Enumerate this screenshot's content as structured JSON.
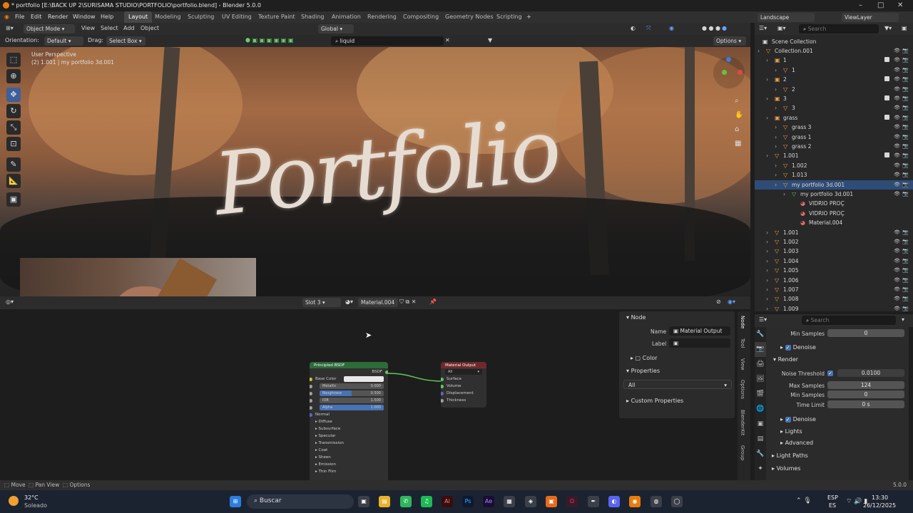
{
  "window": {
    "title": "* portfolio [E:\\BACK UP 2\\SURISAMA STUDIO\\PORTFOLIO\\portfolio.blend] - Blender 5.0.0"
  },
  "menu": [
    "File",
    "Edit",
    "Render",
    "Window",
    "Help"
  ],
  "workspaces": [
    "Layout",
    "Modeling",
    "Sculpting",
    "UV Editing",
    "Texture Paint",
    "Shading",
    "Animation",
    "Rendering",
    "Compositing",
    "Geometry Nodes",
    "Scripting"
  ],
  "active_workspace": "Layout",
  "scene": {
    "name": "Landscape",
    "view_layer": "ViewLayer"
  },
  "viewport_header": {
    "mode": "Object Mode",
    "view": "View",
    "select": "Select",
    "add": "Add",
    "object": "Object",
    "transform": "Global",
    "orientation_label": "Orientation:",
    "orientation": "Default",
    "drag_label": "Drag:",
    "drag": "Select Box",
    "search_value": "liquid",
    "options": "Options"
  },
  "viewport": {
    "info_line1": "User Perspective",
    "info_line2": "(2) 1.001 | my portfolio 3d.001",
    "text_object": "Portfolio"
  },
  "node_editor": {
    "slot": "Slot 3",
    "material": "Material.004",
    "bsdf_node": {
      "title": "Principled BSDF",
      "out": "BSDF",
      "rows": [
        {
          "label": "Base Color",
          "value": ""
        },
        {
          "label": "Metallic",
          "value": "0.000"
        },
        {
          "label": "Roughness",
          "value": "0.500"
        },
        {
          "label": "IOR",
          "value": "1.500"
        },
        {
          "label": "Alpha",
          "value": "1.000"
        }
      ],
      "sections": [
        "Normal",
        "Diffuse",
        "Subsurface",
        "Specular",
        "Transmission",
        "Coat",
        "Sheen",
        "Emission",
        "Thin Film"
      ]
    },
    "output_node": {
      "title": "Material Output",
      "target": "All",
      "inputs": [
        "Surface",
        "Volume",
        "Displacement",
        "Thickness"
      ]
    }
  },
  "n_panel": {
    "node_section": "Node",
    "name_label": "Name",
    "name_value": "Material Output",
    "label_label": "Label",
    "color_section": "Color",
    "properties_section": "Properties",
    "target": "All",
    "custom_properties": "Custom Properties",
    "tabs": [
      "Node",
      "Tool",
      "View",
      "Options",
      "BlenderKit",
      "Group"
    ]
  },
  "outliner": {
    "search_placeholder": "Search",
    "root": "Scene Collection",
    "rows": [
      {
        "name": "Collection.001",
        "indent": 1
      },
      {
        "name": "1",
        "indent": 2
      },
      {
        "name": "1",
        "indent": 3
      },
      {
        "name": "2",
        "indent": 2
      },
      {
        "name": "2",
        "indent": 3
      },
      {
        "name": "3",
        "indent": 2
      },
      {
        "name": "3",
        "indent": 3
      },
      {
        "name": "grass",
        "indent": 2
      },
      {
        "name": "grass 3",
        "indent": 3
      },
      {
        "name": "grass 1",
        "indent": 3
      },
      {
        "name": "grass 2",
        "indent": 3
      },
      {
        "name": "1.001",
        "indent": 2
      },
      {
        "name": "1.002",
        "indent": 3
      },
      {
        "name": "1.013",
        "indent": 3
      },
      {
        "name": "my portfolio 3d.001",
        "indent": 3
      },
      {
        "name": "my portfolio 3d.001",
        "indent": 4
      },
      {
        "name": "VIDRIO PROÇ",
        "indent": 5
      },
      {
        "name": "VIDRIO PROÇ",
        "indent": 5
      },
      {
        "name": "Material.004",
        "indent": 5
      },
      {
        "name": "1.001",
        "indent": 2
      },
      {
        "name": "1.002",
        "indent": 2
      },
      {
        "name": "1.003",
        "indent": 2
      },
      {
        "name": "1.004",
        "indent": 2
      },
      {
        "name": "1.005",
        "indent": 2
      },
      {
        "name": "1.006",
        "indent": 2
      },
      {
        "name": "1.007",
        "indent": 2
      },
      {
        "name": "1.008",
        "indent": 2
      },
      {
        "name": "1.009",
        "indent": 2
      }
    ],
    "selected_index": 14
  },
  "properties": {
    "search_placeholder": "Search",
    "min_samples_label": "Min Samples",
    "min_samples_top": "0",
    "denoise": "Denoise",
    "render_section": "Render",
    "noise_threshold_label": "Noise Threshold",
    "noise_threshold": "0.0100",
    "max_samples_label": "Max Samples",
    "max_samples": "124",
    "min_samples": "0",
    "time_limit_label": "Time Limit",
    "time_limit": "0 s",
    "denoise2": "Denoise",
    "lights": "Lights",
    "advanced": "Advanced",
    "light_paths": "Light Paths",
    "volumes": "Volumes"
  },
  "status_bar": {
    "move": "Move",
    "pan": "Pan View",
    "options": "Options",
    "version": "5.0.0"
  },
  "taskbar": {
    "weather_temp": "32°C",
    "weather_desc": "Soleado",
    "search": "Buscar",
    "lang1": "ESP",
    "lang2": "ES",
    "time": "13:30",
    "date": "26/12/2025"
  },
  "colors": {
    "accent": "#4772b3",
    "selection": "#2f4c77",
    "bsdf_header": "#2d6b3a",
    "output_header": "#6e2a2a"
  }
}
